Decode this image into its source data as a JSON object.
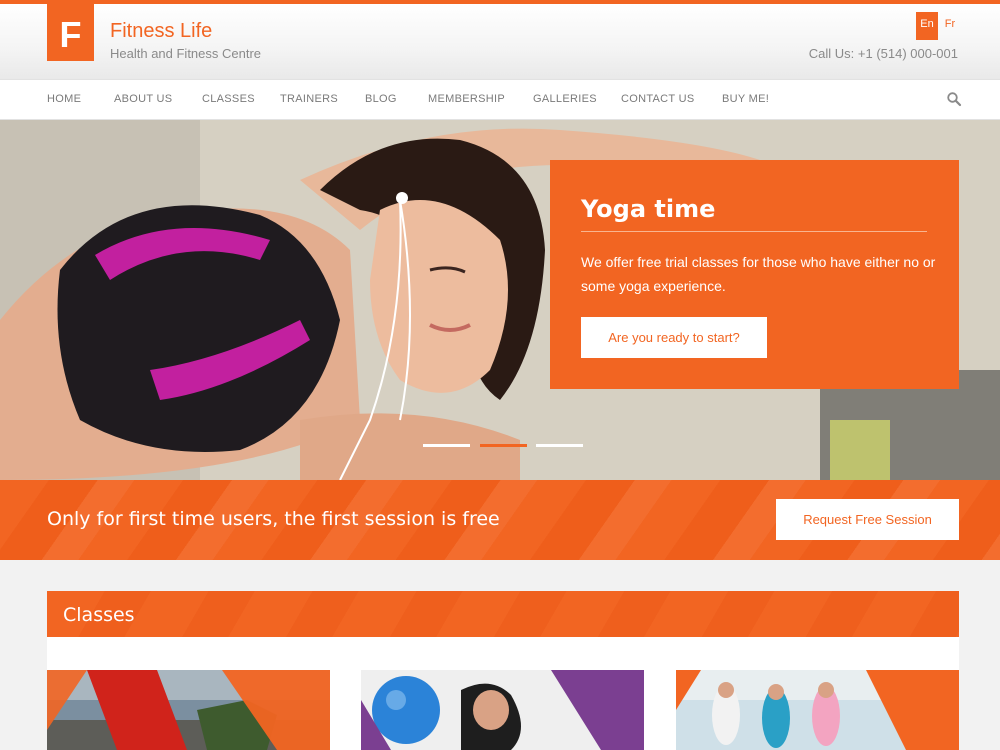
{
  "header": {
    "logo_letter": "F",
    "site_title": "Fitness Life",
    "site_subtitle": "Health and Fitness Centre",
    "lang_en": "En",
    "lang_fr": "Fr",
    "call_us": "Call Us: +1 (514) 000-001"
  },
  "nav": {
    "items": [
      "HOME",
      "ABOUT US",
      "CLASSES",
      "TRAINERS",
      "BLOG",
      "MEMBERSHIP",
      "GALLERIES",
      "CONTACT US",
      "BUY ME!"
    ],
    "search_icon": "search-icon"
  },
  "hero": {
    "title": "Yoga time",
    "text": "We offer free trial classes for those who have either no or some yoga experience.",
    "button": "Are you ready to start?",
    "slides": 3,
    "active_slide": 2
  },
  "promo": {
    "text": "Only for first time users, the first session is free",
    "button": "Request Free Session"
  },
  "classes": {
    "title": "Classes"
  },
  "colors": {
    "accent": "#f26522",
    "text_gray": "#8a8a8a"
  }
}
